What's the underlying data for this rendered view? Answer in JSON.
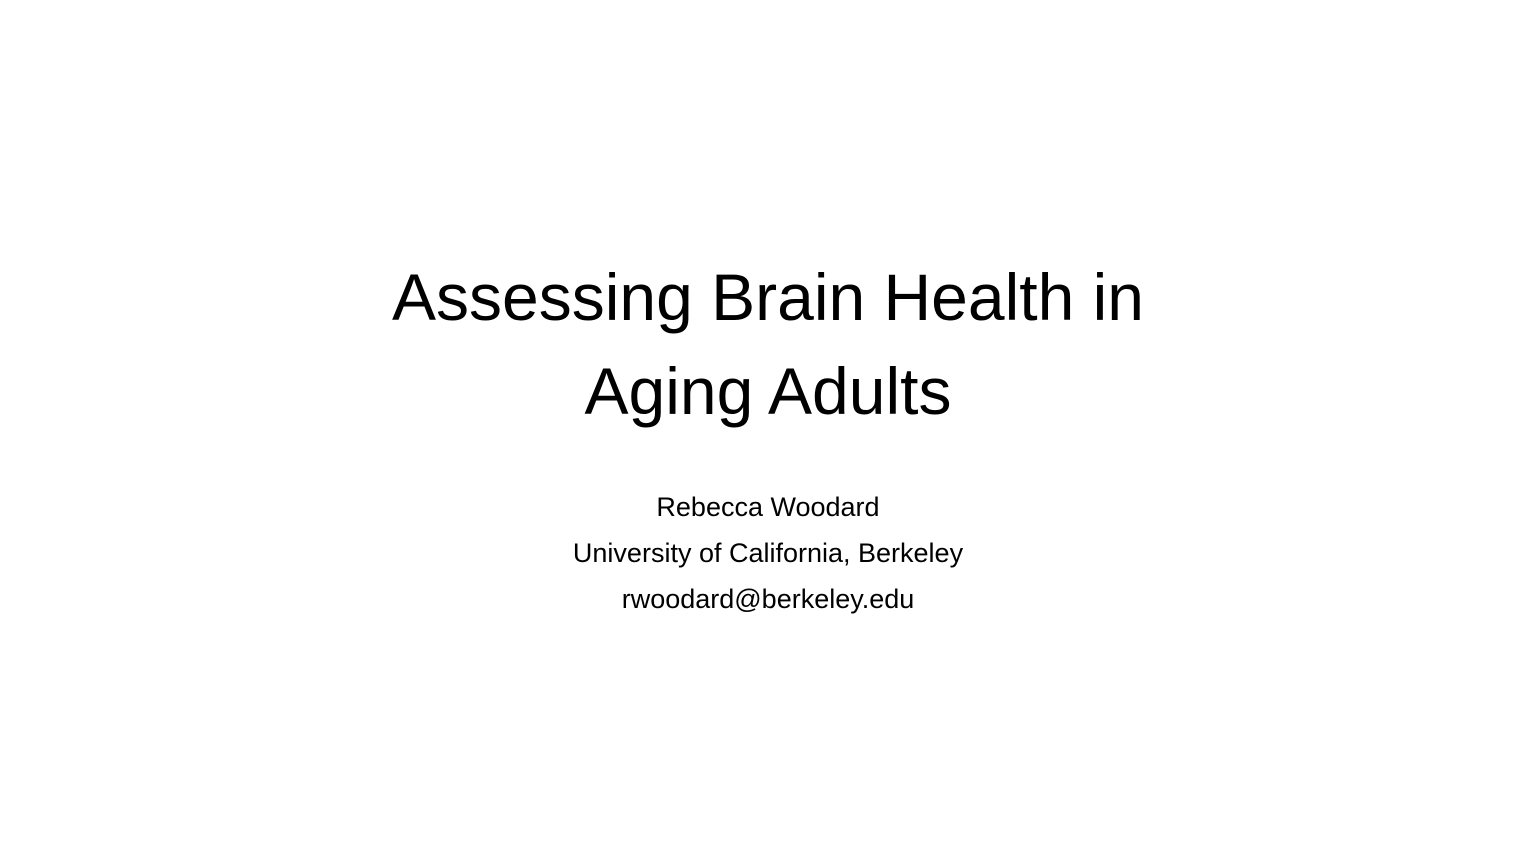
{
  "slide": {
    "title_lines": [
      "Assessing Brain Health in",
      "Aging Adults"
    ],
    "author": "Rebecca Woodard",
    "affiliation": "University of California, Berkeley",
    "email": "rwoodard@berkeley.edu"
  },
  "colors": {
    "background": "#ffffff",
    "text": "#000000"
  }
}
